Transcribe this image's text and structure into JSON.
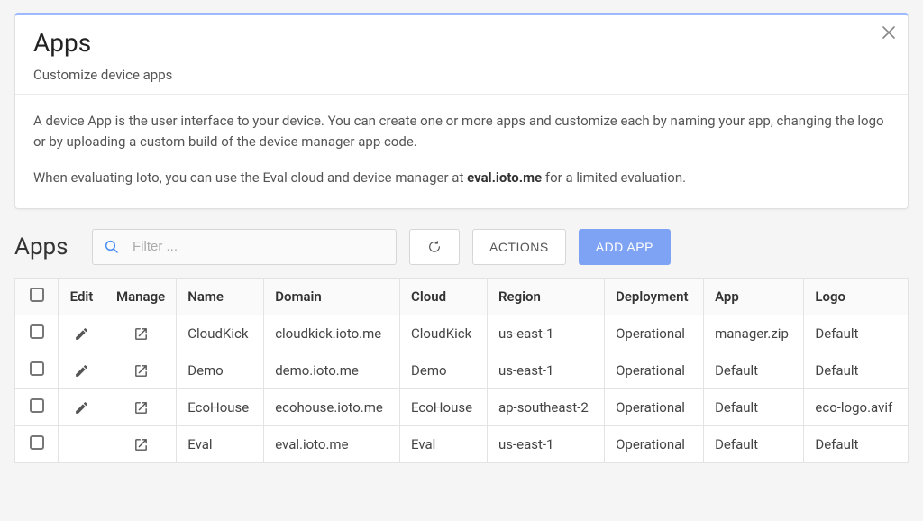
{
  "card": {
    "title": "Apps",
    "subtitle": "Customize device apps",
    "para1": "A device App is the user interface to your device. You can create one or more apps and customize each by naming your app, changing the logo or by uploading a custom build of the device manager app code.",
    "para2a": "When evaluating Ioto, you can use the Eval cloud and device manager at ",
    "para2b": "eval.ioto.me",
    "para2c": " for a limited evaluation."
  },
  "section": {
    "title": "Apps",
    "filter_placeholder": "Filter ...",
    "actions_label": "ACTIONS",
    "add_label": "ADD APP"
  },
  "table": {
    "headers": {
      "edit": "Edit",
      "manage": "Manage",
      "name": "Name",
      "domain": "Domain",
      "cloud": "Cloud",
      "region": "Region",
      "deployment": "Deployment",
      "app": "App",
      "logo": "Logo"
    },
    "rows": [
      {
        "name": "CloudKick",
        "domain": "cloudkick.ioto.me",
        "cloud": "CloudKick",
        "region": "us-east-1",
        "deployment": "Operational",
        "app": "manager.zip",
        "logo": "Default",
        "editable": true
      },
      {
        "name": "Demo",
        "domain": "demo.ioto.me",
        "cloud": "Demo",
        "region": "us-east-1",
        "deployment": "Operational",
        "app": "Default",
        "logo": "Default",
        "editable": true
      },
      {
        "name": "EcoHouse",
        "domain": "ecohouse.ioto.me",
        "cloud": "EcoHouse",
        "region": "ap-southeast-2",
        "deployment": "Operational",
        "app": "Default",
        "logo": "eco-logo.avif",
        "editable": true
      },
      {
        "name": "Eval",
        "domain": "eval.ioto.me",
        "cloud": "Eval",
        "region": "us-east-1",
        "deployment": "Operational",
        "app": "Default",
        "logo": "Default",
        "editable": false
      }
    ]
  }
}
